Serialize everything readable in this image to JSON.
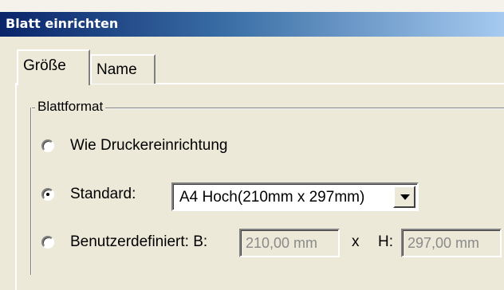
{
  "window": {
    "title": "Blatt einrichten"
  },
  "tabs": [
    {
      "label": "Größe",
      "active": true
    },
    {
      "label": "Name",
      "active": false
    }
  ],
  "group": {
    "label": "Blattformat"
  },
  "options": {
    "printer": {
      "label": "Wie Druckereinrichtung",
      "selected": false
    },
    "standard": {
      "label": "Standard:",
      "selected": true,
      "value": "A4 Hoch(210mm x 297mm)"
    },
    "custom": {
      "label": "Benutzerdefiniert: B:",
      "selected": false,
      "width_value": "210,00 mm",
      "x_label": "x",
      "height_label": "H:",
      "height_value": "297,00 mm"
    }
  }
}
